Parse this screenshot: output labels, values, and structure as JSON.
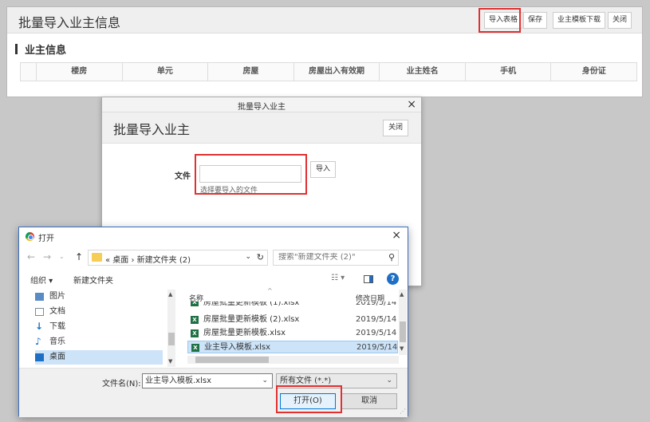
{
  "main": {
    "title": "批量导入业主信息",
    "toolbar": {
      "import_label": "导入表格",
      "save_label": "保存",
      "template_label": "业主模板下载",
      "close_label": "关闭"
    },
    "section_title": "业主信息",
    "table_headers": [
      "楼房",
      "单元",
      "房屋",
      "房屋出入有效期",
      "业主姓名",
      "手机",
      "身份证"
    ]
  },
  "import_dialog": {
    "titlebar": "批量导入业主",
    "close_x": "×",
    "heading": "批量导入业主",
    "close_label": "关闭",
    "file_label": "文件",
    "file_hint": "选择要导入的文件",
    "import_button": "导入"
  },
  "open_dialog": {
    "title": "打开",
    "close_x": "×",
    "nav": {
      "back": "←",
      "forward": "→",
      "recent": "⌄",
      "up": "↑",
      "path": "« 桌面 › 新建文件夹 (2)",
      "dropdown": "⌄",
      "refresh": "↻"
    },
    "search_placeholder": "搜索\"新建文件夹 (2)\"",
    "search_icon": "⚲",
    "toolbar": {
      "organize": "组织 ▾",
      "new_folder": "新建文件夹",
      "view": "☷ ▾",
      "help": "?"
    },
    "nav_items": [
      "图片",
      "文档",
      "下载",
      "音乐",
      "桌面"
    ],
    "columns": {
      "name": "名称",
      "date": "修改日期"
    },
    "files": [
      {
        "name": "房屋批量更新模板 (1).xlsx",
        "date": "2019/5/14"
      },
      {
        "name": "房屋批量更新模板 (2).xlsx",
        "date": "2019/5/14"
      },
      {
        "name": "房屋批量更新模板.xlsx",
        "date": "2019/5/14"
      },
      {
        "name": "业主导入模板.xlsx",
        "date": "2019/5/14"
      }
    ],
    "filename_label": "文件名(N):",
    "filename_value": "业主导入模板.xlsx",
    "filetype_value": "所有文件 (*.*)",
    "open_button": "打开(O)",
    "cancel_button": "取消"
  },
  "colors": {
    "highlight": "#e03030",
    "selection": "#cce3f8",
    "accent": "#0078d7",
    "excel": "#1e7145"
  }
}
